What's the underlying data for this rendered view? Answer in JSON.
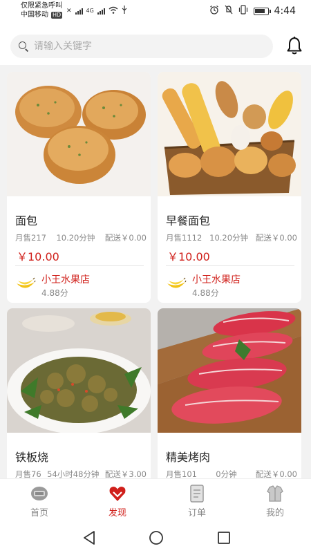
{
  "status_bar": {
    "carrier_line1": "仅限紧急呼叫",
    "carrier_line2": "中国移动",
    "hd": "HD",
    "network": "4G",
    "time": "4:44"
  },
  "search": {
    "placeholder": "请输入关键字"
  },
  "products": [
    {
      "name": "面包",
      "sales": "月售217",
      "time": "10.20分钟",
      "delivery": "配送￥0.00",
      "price": "￥10.00",
      "shop": "小王水果店",
      "rating": "4.88分"
    },
    {
      "name": "早餐面包",
      "sales": "月售1112",
      "time": "10.20分钟",
      "delivery": "配送￥0.00",
      "price": "￥10.00",
      "shop": "小王水果店",
      "rating": "4.88分"
    },
    {
      "name": "铁板烧",
      "sales": "月售76",
      "time": "54小时48分钟",
      "delivery": "配送￥3.00",
      "price": "",
      "shop": "",
      "rating": ""
    },
    {
      "name": "精美烤肉",
      "sales": "月售101",
      "time": "0分钟",
      "delivery": "配送￥0.00",
      "price": "",
      "shop": "",
      "rating": ""
    }
  ],
  "nav": {
    "home": "首页",
    "discover": "发现",
    "orders": "订单",
    "mine": "我的"
  },
  "colors": {
    "accent": "#d0201b",
    "background": "#f2f2f2"
  }
}
